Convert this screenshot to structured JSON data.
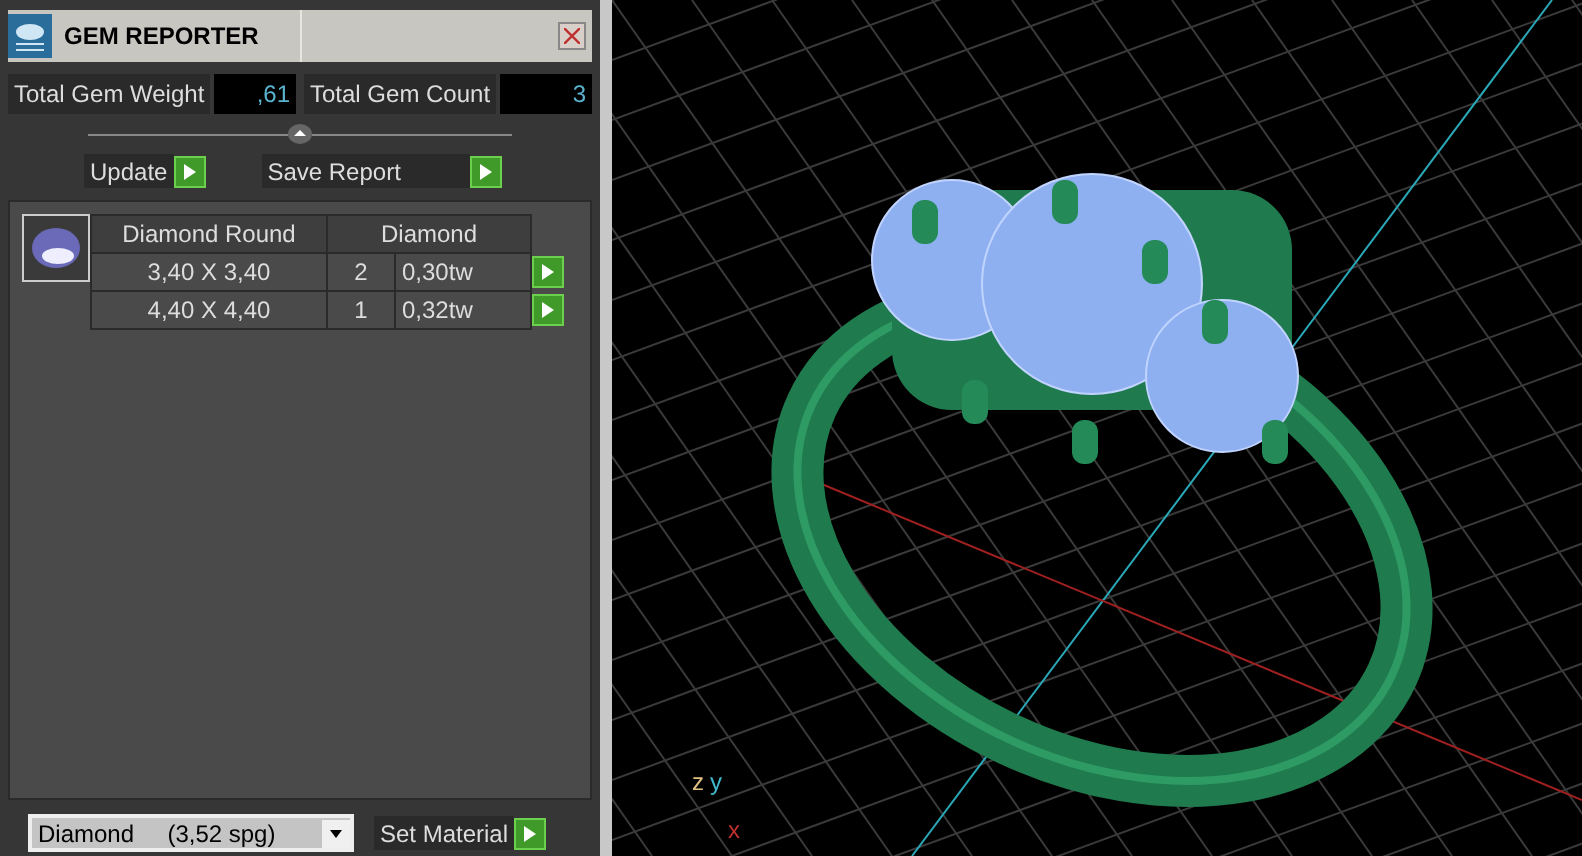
{
  "window": {
    "title": "GEM REPORTER"
  },
  "totals": [
    {
      "label": "Total Gem Weight",
      "value": ",61"
    },
    {
      "label": "Total Gem Count",
      "value": "3"
    }
  ],
  "actions": [
    {
      "label": "Update"
    },
    {
      "label": "Save Report"
    }
  ],
  "gem_table": {
    "columns": [
      "Diamond Round",
      "Diamond"
    ],
    "rows": [
      {
        "size": "3,40 X 3,40",
        "count": "2",
        "weight": "0,30tw"
      },
      {
        "size": "4,40 X 4,40",
        "count": "1",
        "weight": "0,32tw"
      }
    ]
  },
  "material": {
    "value": "Diamond     (3,52 spg)",
    "button": "Set Material"
  },
  "viewport": {
    "axes": [
      {
        "label": "z",
        "color": "#e0c080"
      },
      {
        "label": "y",
        "color": "#40b8d0"
      },
      {
        "label": "x",
        "color": "#c03030"
      }
    ]
  }
}
